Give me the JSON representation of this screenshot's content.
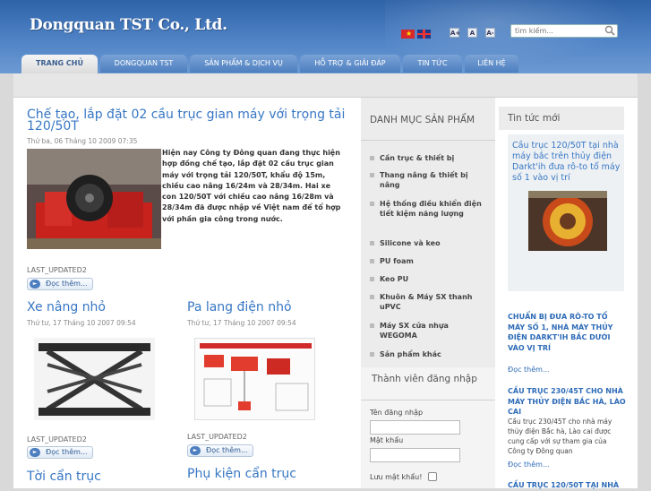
{
  "header": {
    "logo": "Dongquan TST Co., Ltd.",
    "font_labels": [
      "A+",
      "A",
      "A-"
    ],
    "search": {
      "placeholder": "tìm kiếm..."
    }
  },
  "nav": {
    "tabs": [
      "TRANG CHỦ",
      "DONGQUAN TST",
      "SẢN PHẨM & DỊCH VỤ",
      "HỖ TRỢ & GIẢI ĐÁP",
      "TIN TỨC",
      "LIÊN HỆ"
    ],
    "active": 0
  },
  "feature": {
    "title": "Chế tạo, lắp đặt 02 cầu trục gian máy với trọng tải 120/50T",
    "date": "Thứ ba, 06 Tháng 10 2009 07:35",
    "intro": "Hiện nay Công ty Đông quan đang thực hiện hợp đồng chế tạo, lắp đặt 02 cầu trục gian máy với trọng tải 120/50T, khẩu độ 15m, chiều cao nâng 16/24m và 28/34m. Hai xe con 120/50T với chiều cao nâng 16/28m và 28/34m đã được nhập về Việt nam để tổ hợp với phần gia công trong nước.",
    "updated": "LAST_UPDATED2",
    "more": "Đọc thêm..."
  },
  "articles": [
    {
      "title": "Xe nâng nhỏ",
      "date": "Thứ tư, 17 Tháng 10 2007 09:54",
      "updated": "LAST_UPDATED2",
      "more": "Đọc thêm..."
    },
    {
      "title": "Pa lang điện nhỏ",
      "date": "Thứ tư, 17 Tháng 10 2007 09:54",
      "updated": "LAST_UPDATED2",
      "more": "Đọc thêm..."
    },
    {
      "title": "Tời cẩn trục",
      "date": "",
      "updated": "",
      "more": ""
    },
    {
      "title": "Phụ kiện cẩn trục",
      "date": "",
      "updated": "",
      "more": ""
    }
  ],
  "categories": {
    "title": "DANH MỤC SẢN PHẨM",
    "items": [
      "Cần trục & thiết bị",
      "Thang nâng & thiết bị nâng",
      "Hệ thống điều khiển điện tiết kiệm năng lượng",
      "Silicone và keo",
      "PU foam",
      "Keo PU",
      "Khuôn & Máy SX thanh uPVC",
      "Máy SX cửa nhựa WEGOMA",
      "Sản phẩm khác"
    ]
  },
  "login": {
    "title": "Thành viên đăng nhập",
    "username_label": "Tên đăng nhập",
    "password_label": "Mật khẩu",
    "remember_label": "Lưu mật khẩu!"
  },
  "news": {
    "title": "Tin tức mới",
    "featured": "Cầu trục 120/50T tại nhà máy bắc trên thủy điện Darkt'ih đưa rô-to tổ máy số 1 vào vị trí",
    "items": [
      {
        "title": "CHUẨN BỊ ĐƯA RÔ-TO TỔ MÁY SỐ 1, NHÀ MÁY THỦY ĐIỆN DARKT'IH BẮC DƯỚI VÀO VỊ TRÍ",
        "more": "Đọc thêm..."
      },
      {
        "title": "CẦU TRỤC 230/45T CHO NHÀ MÁY THỦY ĐIỆN BẮC HÀ, LÀO CAI",
        "body": "Cầu trục 230/45T cho nhà máy thủy điện Bắc hà, Lào cai được cung cấp với sự tham gia của Công ty Đông quan",
        "more": "Đọc thêm..."
      },
      {
        "title": "CẦU TRỤC 120/50T TẠI NHÀ"
      }
    ]
  },
  "colors": {
    "header": "#3a6db2",
    "link": "#3777c4",
    "tab": "#5a89c7"
  }
}
